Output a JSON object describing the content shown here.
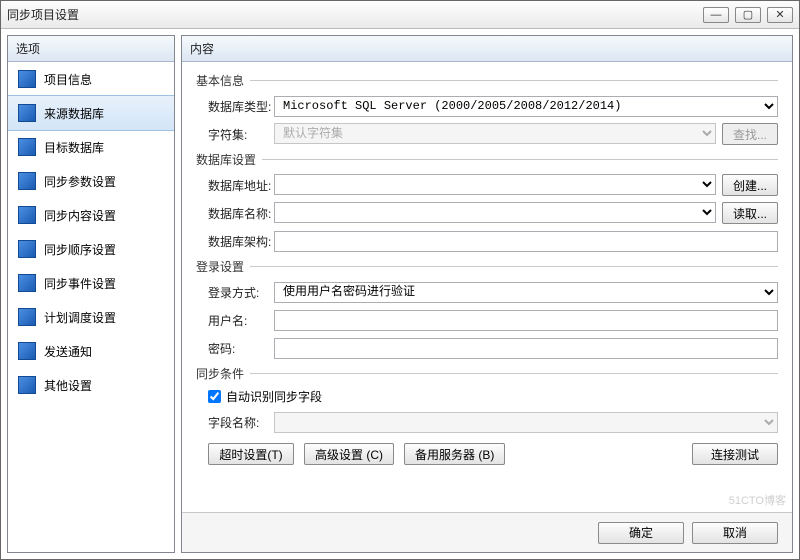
{
  "window": {
    "title": "同步项目设置"
  },
  "sidebar": {
    "header": "选项",
    "items": [
      {
        "label": "项目信息"
      },
      {
        "label": "来源数据库"
      },
      {
        "label": "目标数据库"
      },
      {
        "label": "同步参数设置"
      },
      {
        "label": "同步内容设置"
      },
      {
        "label": "同步顺序设置"
      },
      {
        "label": "同步事件设置"
      },
      {
        "label": "计划调度设置"
      },
      {
        "label": "发送通知"
      },
      {
        "label": "其他设置"
      }
    ],
    "selected_index": 1
  },
  "content": {
    "header": "内容",
    "groups": {
      "basic": {
        "title": "基本信息",
        "db_type_label": "数据库类型:",
        "db_type_value": "Microsoft SQL Server (2000/2005/2008/2012/2014)",
        "charset_label": "字符集:",
        "charset_value": "默认字符集",
        "lookup_btn": "查找..."
      },
      "db": {
        "title": "数据库设置",
        "addr_label": "数据库地址:",
        "addr_value": "",
        "create_btn": "创建...",
        "name_label": "数据库名称:",
        "name_value": "",
        "read_btn": "读取...",
        "schema_label": "数据库架构:",
        "schema_value": ""
      },
      "login": {
        "title": "登录设置",
        "method_label": "登录方式:",
        "method_value": "使用用户名密码进行验证",
        "user_label": "用户名:",
        "user_value": "",
        "pwd_label": "密码:",
        "pwd_value": ""
      },
      "sync": {
        "title": "同步条件",
        "auto_chk": "自动识别同步字段",
        "auto_checked": true,
        "field_label": "字段名称:",
        "field_value": ""
      }
    },
    "buttons": {
      "timeout": "超时设置(T)",
      "advanced": "高级设置 (C)",
      "backup": "备用服务器 (B)",
      "test": "连接测试"
    }
  },
  "footer": {
    "ok": "确定",
    "cancel": "取消"
  },
  "watermark": "51CTO博客"
}
